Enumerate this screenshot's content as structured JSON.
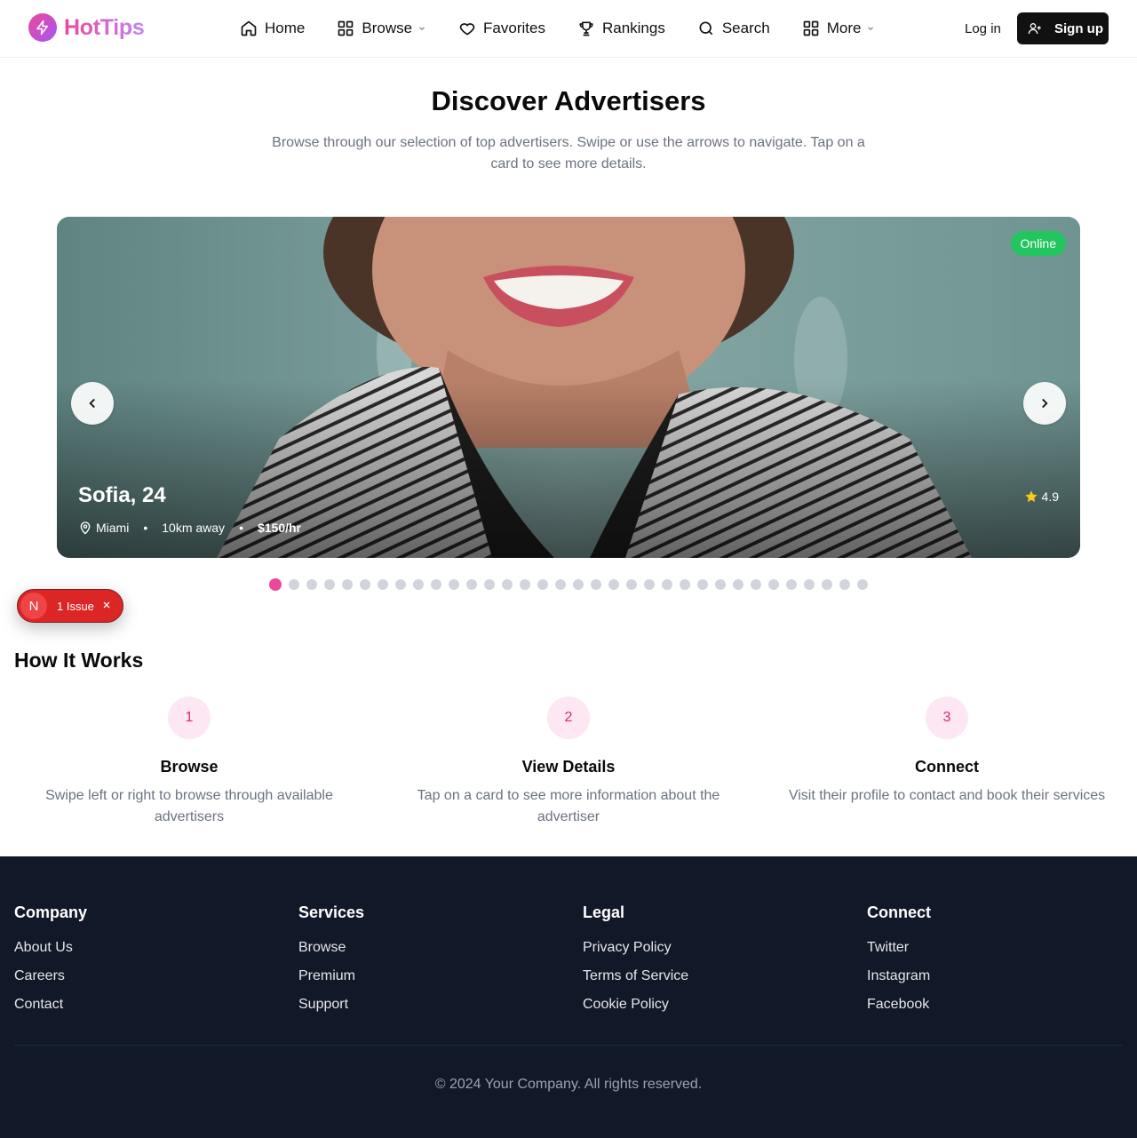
{
  "header": {
    "brand": "HotTips",
    "nav": [
      {
        "label": "Home",
        "icon": "home-icon"
      },
      {
        "label": "Browse",
        "icon": "grid-icon",
        "dropdown": true
      },
      {
        "label": "Favorites",
        "icon": "heart-icon"
      },
      {
        "label": "Rankings",
        "icon": "trophy-icon"
      },
      {
        "label": "Search",
        "icon": "search-icon"
      },
      {
        "label": "More",
        "icon": "grid-icon",
        "dropdown": true
      }
    ],
    "login_label": "Log in",
    "signup_label": "Sign up"
  },
  "hero": {
    "title": "Discover Advertisers",
    "subtitle": "Browse through our selection of top advertisers. Swipe or use the arrows to navigate. Tap on a card to see more details."
  },
  "card": {
    "status": "Online",
    "name": "Sofia, 24",
    "location": "Miami",
    "distance": "10km away",
    "price": "$150/hr",
    "rating": "4.9"
  },
  "carousel": {
    "total": 34,
    "active_index": 0
  },
  "issue_badge": {
    "initial": "N",
    "label": "1 Issue"
  },
  "how_it_works": {
    "title": "How It Works",
    "steps": [
      {
        "number": "1",
        "title": "Browse",
        "description": "Swipe left or right to browse through available advertisers"
      },
      {
        "number": "2",
        "title": "View Details",
        "description": "Tap on a card to see more information about the advertiser"
      },
      {
        "number": "3",
        "title": "Connect",
        "description": "Visit their profile to contact and book their services"
      }
    ]
  },
  "footer": {
    "columns": [
      {
        "title": "Company",
        "links": [
          "About Us",
          "Careers",
          "Contact"
        ]
      },
      {
        "title": "Services",
        "links": [
          "Browse",
          "Premium",
          "Support"
        ]
      },
      {
        "title": "Legal",
        "links": [
          "Privacy Policy",
          "Terms of Service",
          "Cookie Policy"
        ]
      },
      {
        "title": "Connect",
        "links": [
          "Twitter",
          "Instagram",
          "Facebook"
        ]
      }
    ],
    "copyright": "© 2024 Your Company. All rights reserved."
  },
  "colors": {
    "accent": "#ec4899",
    "online": "#22c55e",
    "footer_bg": "#111827",
    "issue": "#dc2626"
  }
}
